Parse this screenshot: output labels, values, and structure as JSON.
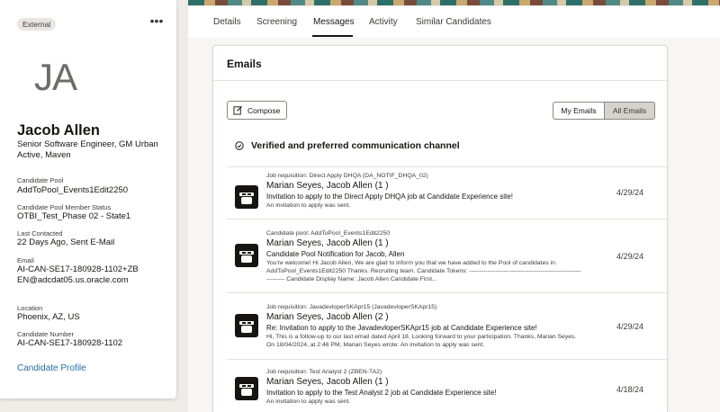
{
  "profile": {
    "badge": "External",
    "more_label": "•••",
    "initials": "JA",
    "name": "Jacob Allen",
    "title": "Senior Software Engineer, GM Urban Active, Maven",
    "fields": [
      {
        "label": "Candidate Pool",
        "value": "AddToPool_Events1Edit2250"
      },
      {
        "label": "Candidate Pool Member Status",
        "value": "OTBI_Test_Phase 02 - State1"
      },
      {
        "label": "Last Contacted",
        "value": "22 Days Ago, Sent E-Mail"
      },
      {
        "label": "Email",
        "value": "AI-CAN-SE17-180928-1102+ZBEN@adcdat05.us.oracle.com"
      },
      {
        "label": "Location",
        "value": "Phoenix, AZ, US"
      },
      {
        "label": "Candidate Number",
        "value": "AI-CAN-SE17-180928-1102"
      }
    ],
    "profile_link": "Candidate Profile"
  },
  "tabs": [
    {
      "label": "Details"
    },
    {
      "label": "Screening"
    },
    {
      "label": "Messages",
      "active": true
    },
    {
      "label": "Activity"
    },
    {
      "label": "Similar Candidates"
    }
  ],
  "emails": {
    "title": "Emails",
    "compose_label": "Compose",
    "filter": {
      "my": "My Emails",
      "all": "All Emails",
      "selected": "All Emails"
    },
    "channel_label": "Verified and preferred communication channel",
    "items": [
      {
        "kicker": "Job requisition: Direct Apply DHQA (DA_NOTIF_DHQA_02)",
        "from": "Marian Seyes, Jacob Allen (1 )",
        "subject": "Invitation to apply to the Direct Apply DHQA job at Candidate Experience site!",
        "snippet": "An invitation to apply was sent.",
        "date": "4/29/24"
      },
      {
        "kicker": "Candidate pool: AddToPool_Events1Edit2250",
        "from": "Marian Seyes, Jacob Allen (1 )",
        "subject": "Candidate Pool Notification for Jacob, Allen",
        "snippet": "You're welcome! Hi Jacob Allen, We are glad to inform you that we have added to the Pool of candidates in: AddToPool_Events1Edit2250 Thanks. Recruiting team. Candidate Tokens: ---------------------------------------------------------------- Candidate Display Name: Jacob Allen Candidate First...",
        "date": "4/29/24"
      },
      {
        "kicker": "Job requisition: JavadevloperSKApr15 (JavadevloperSKApr15)",
        "from": "Marian Seyes, Jacob Allen (2 )",
        "subject": "Re: Invitation to apply to the JavadevloperSKApr15 job at Candidate Experience site!",
        "snippet": "Hi, This is a follow-up to our last email dated April 18. Looking forward to your participation. Thanks, Marian Seyes. On 18/04/2024, at 2:46 PM, Marian Seyes wrote: An invitation to apply was sent.",
        "date": "4/29/24"
      },
      {
        "kicker": "Job requisition: Test Analyst 2 (ZBEN-TA2)",
        "from": "Marian Seyes, Jacob Allen (1 )",
        "subject": "Invitation to apply to the Test Analyst 2 job at Candidate Experience site!",
        "snippet": "An invitation to apply was sent.",
        "date": "4/18/24"
      }
    ]
  },
  "colors": {
    "accent_link": "#1f6f9f",
    "active_tab": "#161513",
    "avatar_bg": "#161513"
  }
}
